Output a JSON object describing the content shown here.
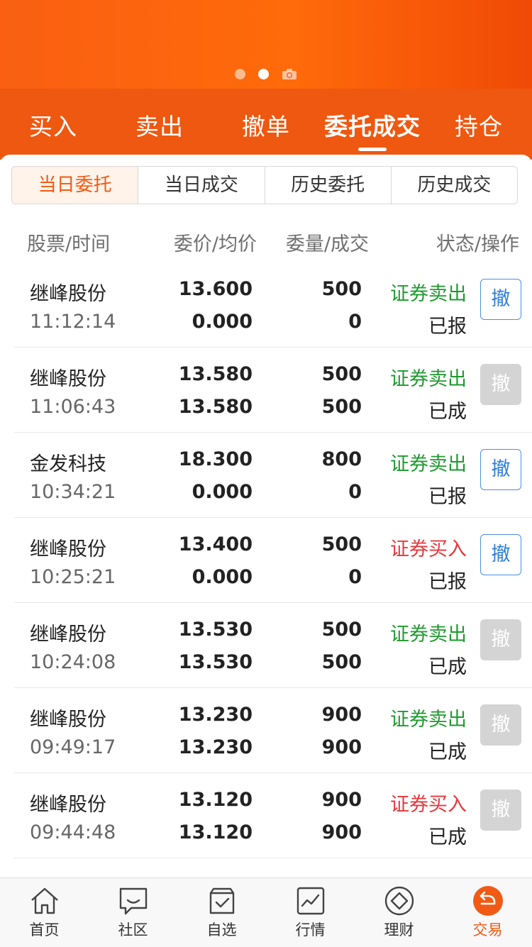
{
  "tabs": [
    "买入",
    "卖出",
    "撤单",
    "委托成交",
    "持仓"
  ],
  "active_tab_index": 3,
  "segments": [
    "当日委托",
    "当日成交",
    "历史委托",
    "历史成交"
  ],
  "active_segment_index": 0,
  "columns": {
    "stock_time": "股票/时间",
    "price": "委价/均价",
    "qty": "委量/成交",
    "status": "状态/操作"
  },
  "colors": {
    "accent": "#f05a14",
    "sell": "#1f9a2f",
    "buy": "#e8373b",
    "cancel_active": "#2f7fdb",
    "cancel_disabled": "#d4d4d4"
  },
  "orders": [
    {
      "name": "继峰股份",
      "time": "11:12:14",
      "order_price": "13.600",
      "avg_price": "0.000",
      "order_qty": "500",
      "filled_qty": "0",
      "action": "证券卖出",
      "side": "sell",
      "status": "已报",
      "cancel": "撤",
      "cancel_enabled": true
    },
    {
      "name": "继峰股份",
      "time": "11:06:43",
      "order_price": "13.580",
      "avg_price": "13.580",
      "order_qty": "500",
      "filled_qty": "500",
      "action": "证券卖出",
      "side": "sell",
      "status": "已成",
      "cancel": "撤",
      "cancel_enabled": false
    },
    {
      "name": "金发科技",
      "time": "10:34:21",
      "order_price": "18.300",
      "avg_price": "0.000",
      "order_qty": "800",
      "filled_qty": "0",
      "action": "证券卖出",
      "side": "sell",
      "status": "已报",
      "cancel": "撤",
      "cancel_enabled": true
    },
    {
      "name": "继峰股份",
      "time": "10:25:21",
      "order_price": "13.400",
      "avg_price": "0.000",
      "order_qty": "500",
      "filled_qty": "0",
      "action": "证券买入",
      "side": "buy",
      "status": "已报",
      "cancel": "撤",
      "cancel_enabled": true
    },
    {
      "name": "继峰股份",
      "time": "10:24:08",
      "order_price": "13.530",
      "avg_price": "13.530",
      "order_qty": "500",
      "filled_qty": "500",
      "action": "证券卖出",
      "side": "sell",
      "status": "已成",
      "cancel": "撤",
      "cancel_enabled": false
    },
    {
      "name": "继峰股份",
      "time": "09:49:17",
      "order_price": "13.230",
      "avg_price": "13.230",
      "order_qty": "900",
      "filled_qty": "900",
      "action": "证券卖出",
      "side": "sell",
      "status": "已成",
      "cancel": "撤",
      "cancel_enabled": false
    },
    {
      "name": "继峰股份",
      "time": "09:44:48",
      "order_price": "13.120",
      "avg_price": "13.120",
      "order_qty": "900",
      "filled_qty": "900",
      "action": "证券买入",
      "side": "buy",
      "status": "已成",
      "cancel": "撤",
      "cancel_enabled": false
    }
  ],
  "bottom_nav": [
    {
      "label": "首页",
      "icon": "home-icon"
    },
    {
      "label": "社区",
      "icon": "chat-icon"
    },
    {
      "label": "自选",
      "icon": "watchlist-icon"
    },
    {
      "label": "行情",
      "icon": "chart-icon"
    },
    {
      "label": "理财",
      "icon": "wealth-icon"
    },
    {
      "label": "交易",
      "icon": "trade-icon"
    }
  ],
  "active_nav_index": 5
}
